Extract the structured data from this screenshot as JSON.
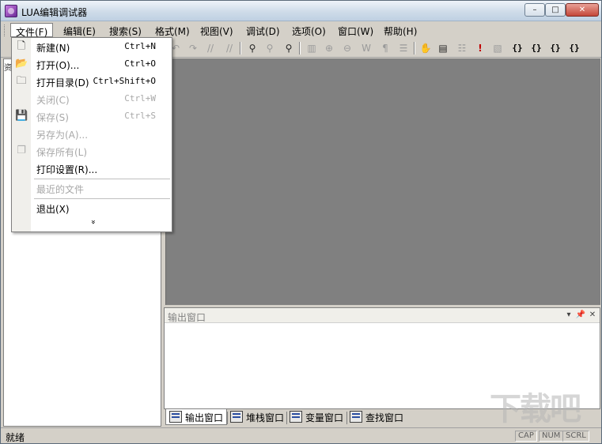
{
  "window": {
    "title": "LUA编辑调试器"
  },
  "controls": {
    "min": "–",
    "max": "□",
    "close": "✕"
  },
  "menubar": {
    "items": [
      {
        "label": "文件(F)"
      },
      {
        "label": "编辑(E)"
      },
      {
        "label": "搜索(S)"
      },
      {
        "label": "格式(M)"
      },
      {
        "label": "视图(V)"
      },
      {
        "label": "调试(D)"
      },
      {
        "label": "选项(O)"
      },
      {
        "label": "窗口(W)"
      },
      {
        "label": "帮助(H)"
      }
    ]
  },
  "toolbar": {
    "buttons": [
      {
        "icon": "undo-icon",
        "glyph": "↶"
      },
      {
        "icon": "redo-icon",
        "glyph": "↷"
      },
      {
        "icon": "comment-icon",
        "glyph": "//"
      },
      {
        "icon": "uncomment-icon",
        "glyph": "//"
      },
      {
        "icon": "find-icon",
        "glyph": "⚲"
      },
      {
        "icon": "find-next-icon",
        "glyph": "⚲"
      },
      {
        "icon": "find-in-files-icon",
        "glyph": "⚲"
      },
      {
        "icon": "book-icon",
        "glyph": "▥"
      },
      {
        "icon": "zoom-in-icon",
        "glyph": "⊕"
      },
      {
        "icon": "zoom-out-icon",
        "glyph": "⊖"
      },
      {
        "icon": "word-wrap-icon",
        "glyph": "W"
      },
      {
        "icon": "paragraph-icon",
        "glyph": "¶"
      },
      {
        "icon": "indent-icon",
        "glyph": "☰"
      },
      {
        "icon": "hand-icon",
        "glyph": "✋"
      },
      {
        "icon": "stack-icon",
        "glyph": "▤"
      },
      {
        "icon": "list-icon",
        "glyph": "☷"
      },
      {
        "icon": "breakpoint-icon",
        "glyph": "!"
      },
      {
        "icon": "clear-icon",
        "glyph": "▧"
      },
      {
        "icon": "step-into-icon",
        "glyph": "{}"
      },
      {
        "icon": "step-over-icon",
        "glyph": "{}"
      },
      {
        "icon": "step-out-icon",
        "glyph": "{}"
      },
      {
        "icon": "run-to-cursor-icon",
        "glyph": "{}"
      }
    ]
  },
  "file_menu": {
    "items": [
      {
        "label": "新建(N)",
        "shortcut": "Ctrl+N",
        "icon": "new-file-icon",
        "glyph": "🗋",
        "enabled": true
      },
      {
        "label": "打开(O)...",
        "shortcut": "Ctrl+O",
        "icon": "open-folder-icon",
        "glyph": "📂",
        "enabled": true
      },
      {
        "label": "打开目录(D)",
        "shortcut": "Ctrl+Shift+O",
        "icon": "open-directory-icon",
        "glyph": "🗀",
        "enabled": true
      },
      {
        "label": "关闭(C)",
        "shortcut": "Ctrl+W",
        "icon": "",
        "glyph": "",
        "enabled": false
      },
      {
        "label": "保存(S)",
        "shortcut": "Ctrl+S",
        "icon": "save-icon",
        "glyph": "💾",
        "enabled": false
      },
      {
        "label": "另存为(A)...",
        "shortcut": "",
        "icon": "",
        "glyph": "",
        "enabled": false
      },
      {
        "label": "保存所有(L)",
        "shortcut": "",
        "icon": "save-all-icon",
        "glyph": "❐",
        "enabled": false
      },
      {
        "label": "打印设置(R)...",
        "shortcut": "",
        "icon": "",
        "glyph": "",
        "enabled": true
      },
      {
        "label": "最近的文件",
        "shortcut": "",
        "icon": "",
        "glyph": "",
        "enabled": false
      },
      {
        "label": "退出(X)",
        "shortcut": "",
        "icon": "",
        "glyph": "",
        "enabled": true
      }
    ],
    "more": "»"
  },
  "output_panel": {
    "title": "输出窗口",
    "dropdown_glyph": "▾",
    "pin_glyph": "📌",
    "close_glyph": "✕"
  },
  "bottom_tabs": [
    {
      "label": "输出窗口",
      "icon": "output-window-icon",
      "active": true
    },
    {
      "label": "堆栈窗口",
      "icon": "stack-window-icon",
      "active": false
    },
    {
      "label": "变量窗口",
      "icon": "variables-window-icon",
      "active": false
    },
    {
      "label": "查找窗口",
      "icon": "find-window-icon",
      "active": false
    }
  ],
  "statusbar": {
    "text": "就绪",
    "indicators": [
      "CAP",
      "NUM",
      "SCRL"
    ]
  },
  "left_pane": {
    "tab_label": "资"
  },
  "watermark": {
    "text": "下载吧"
  }
}
